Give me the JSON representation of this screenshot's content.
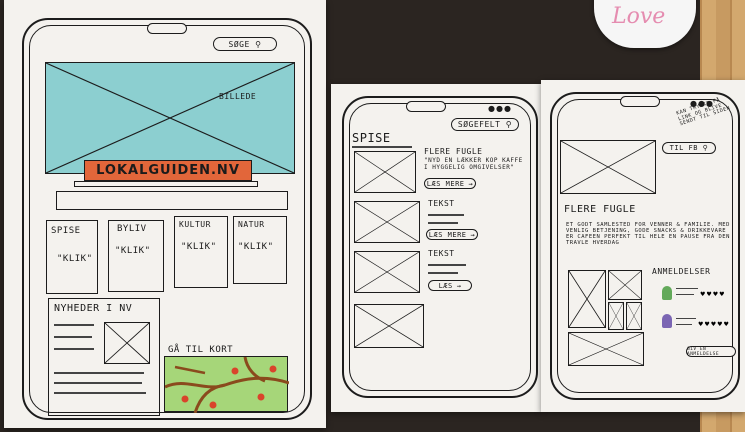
{
  "left_sketch": {
    "search_label": "SØGE ⚲",
    "image_label": "BILLEDE",
    "logo_text": "LOKALGUIDEN.NV",
    "categories": [
      {
        "title": "SPISE",
        "action": "\"KLIK\""
      },
      {
        "title": "BYLIV",
        "action": "\"KLIK\""
      },
      {
        "title": "KULTUR",
        "action": "\"KLIK\""
      },
      {
        "title": "NATUR",
        "action": "\"KLIK\""
      }
    ],
    "news_title": "NYHEDER I NV",
    "map_label": "GÅ TIL KORT"
  },
  "middle_sketch": {
    "search_label": "SØGEFELT ⚲",
    "section_title": "SPISE",
    "items": [
      {
        "title": "FLERE FUGLE",
        "desc": "\"NYD EN LÆKKER KOP KAFFE I HYGGELIG OMGIVELSER\"",
        "button": "LÆS MERE"
      },
      {
        "title": "TEKST",
        "desc": "",
        "button": "LÆS MERE"
      },
      {
        "title": "TEKST",
        "desc": "",
        "button": "LÆS"
      }
    ]
  },
  "right_sketch": {
    "note": "KAN TRYKKE PÅ LINK OG BLIVE SENDT TIL SIDEN",
    "link_button": "TIL FB ⚲",
    "place_title": "FLERE FUGLE",
    "description": "ET GODT SAMLESTED FOR VENNER & FAMILIE. MED VENLIG BETJENING, GODE SNACKS & DRIKKEVARE ER CAFEEN PERFEKT TIL HELE EN PAUSE FRA DEN TRAVLE HVERDAG",
    "reviews_title": "ANMELDELSER",
    "review_button": "GIV EN ANMELDELSE"
  },
  "mug_text": "Love",
  "colors": {
    "paper": "#f4f2ee",
    "image_fill": "#8ccfd0",
    "logo_fill": "#e2663a",
    "map_fill": "#a6d679",
    "road": "#8a4a1d",
    "pin": "#d9442b",
    "avatar_green": "#63a95a",
    "avatar_purple": "#7b66b3",
    "table": "#2a2420",
    "wood": "#c79a61"
  }
}
